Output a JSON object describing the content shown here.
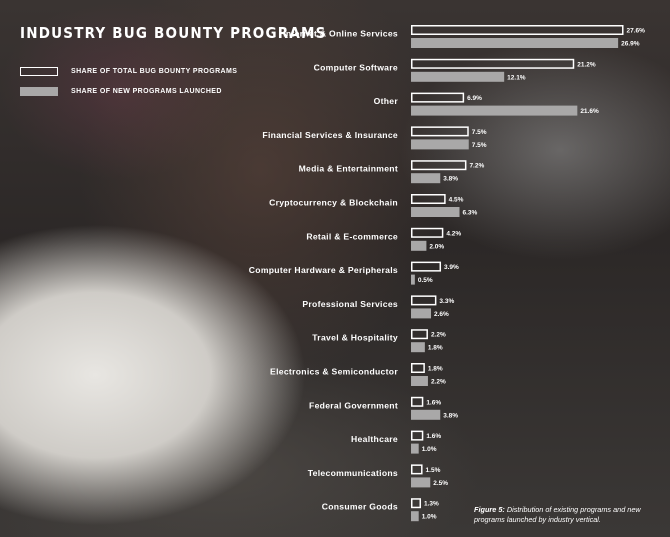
{
  "title": "INDUSTRY BUG BOUNTY PROGRAMS",
  "caption_prefix": "Figure 5:",
  "caption_text": "Distribution of existing programs and new programs launched by industry vertical.",
  "colors": {
    "total_outline": "#ffffff",
    "new_fill": "#a9a8a8",
    "text": "#ffffff"
  },
  "chart_data": {
    "type": "bar",
    "orientation": "horizontal",
    "legend_placement": "top-left",
    "grid": false,
    "xlim": [
      0,
      30
    ],
    "categories": [
      "Internet & Online Services",
      "Computer Software",
      "Other",
      "Financial Services & Insurance",
      "Media & Entertainment",
      "Cryptocurrency & Blockchain",
      "Retail & E-commerce",
      "Computer Hardware & Peripherals",
      "Professional Services",
      "Travel & Hospitality",
      "Electronics & Semiconductor",
      "Federal Government",
      "Healthcare",
      "Telecommunications",
      "Consumer Goods"
    ],
    "series": [
      {
        "name": "SHARE OF TOTAL BUG BOUNTY PROGRAMS",
        "style": "outline",
        "values": [
          27.6,
          21.2,
          6.9,
          7.5,
          7.2,
          4.5,
          4.2,
          3.9,
          3.3,
          2.2,
          1.8,
          1.6,
          1.6,
          1.5,
          1.3
        ],
        "labels": [
          "27.6%",
          "21.2%",
          "6.9%",
          "7.5%",
          "7.2%",
          "4.5%",
          "4.2%",
          "3.9%",
          "3.3%",
          "2.2%",
          "1.8%",
          "1.6%",
          "1.6%",
          "1.5%",
          "1.3%"
        ]
      },
      {
        "name": "SHARE OF NEW PROGRAMS LAUNCHED",
        "style": "filled",
        "values": [
          26.9,
          12.1,
          21.6,
          7.5,
          3.8,
          6.3,
          2.0,
          0.5,
          2.6,
          1.8,
          2.2,
          3.8,
          1.0,
          2.5,
          1.0
        ],
        "labels": [
          "26.9%",
          "12.1%",
          "21.6%",
          "7.5%",
          "3.8%",
          "6.3%",
          "2.0%",
          "0.5%",
          "2.6%",
          "1.8%",
          "2.2%",
          "3.8%",
          "1.0%",
          "2.5%",
          "1.0%"
        ]
      }
    ]
  }
}
